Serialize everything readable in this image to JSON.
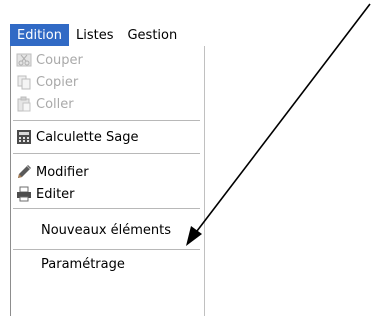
{
  "menubar": {
    "items": [
      {
        "label": "Edition",
        "active": true
      },
      {
        "label": "Listes",
        "active": false
      },
      {
        "label": "Gestion",
        "active": false
      }
    ]
  },
  "menu": {
    "items": [
      {
        "label": "Couper",
        "icon": "scissors-icon",
        "enabled": false
      },
      {
        "label": "Copier",
        "icon": "copy-icon",
        "enabled": false
      },
      {
        "label": "Coller",
        "icon": "paste-icon",
        "enabled": false
      },
      {
        "label": "Calculette Sage",
        "icon": "calculator-icon",
        "enabled": true
      },
      {
        "label": "Modifier",
        "icon": "pencil-icon",
        "enabled": true
      },
      {
        "label": "Editer",
        "icon": "printer-icon",
        "enabled": true
      },
      {
        "label": "Nouveaux éléments",
        "icon": null,
        "enabled": true
      },
      {
        "label": "Paramétrage",
        "icon": null,
        "enabled": true
      }
    ]
  },
  "colors": {
    "highlight": "#316ac5",
    "disabled_text": "#a9a9a9"
  }
}
